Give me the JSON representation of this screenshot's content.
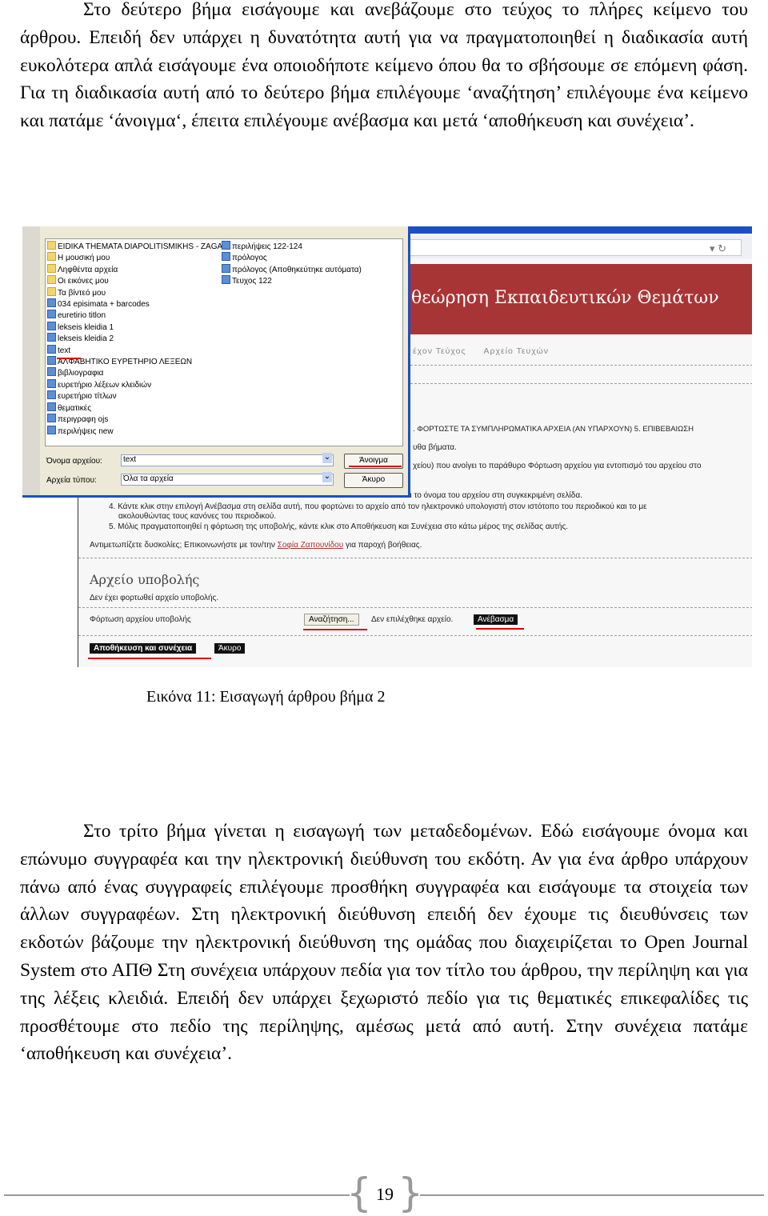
{
  "paragraphs": [
    "Στο δεύτερο βήμα εισάγουμε και ανεβάζουμε στο τεύχος το πλήρες κείμενο του άρθρου. Επειδή δεν υπάρχει η δυνατότητα αυτή για να πραγματοποιηθεί η διαδικασία αυτή ευκολότερα απλά εισάγουμε ένα οποιοδήποτε κείμενο όπου θα το σβήσουμε σε επόμενη φάση. Για τη διαδικασία αυτή από το δεύτερο βήμα επιλέγουμε ‘αναζήτηση’ επιλέγουμε ένα κείμενο και πατάμε ‘άνοιγμα‘, έπειτα επιλέγουμε ανέβασμα και μετά ‘αποθήκευση και συνέχεια’.",
    "Στο τρίτο βήμα γίνεται η εισαγωγή των μεταδεδομένων. Εδώ εισάγουμε όνομα και επώνυμο συγγραφέα και την ηλεκτρονική διεύθυνση του εκδότη. Αν για ένα άρθρο υπάρχουν πάνω από ένας συγγραφείς επιλέγουμε προσθήκη συγγραφέα και εισάγουμε τα στοιχεία των άλλων συγγραφέων. Στη ηλεκτρονική διεύθυνση επειδή δεν έχουμε τις διευθύνσεις των εκδοτών βάζουμε την ηλεκτρονική διεύθυνση της ομάδας που διαχειρίζεται το Open Journal System στο ΑΠΘ Στη συνέχεια υπάρχουν πεδία για τον τίτλο του άρθρου, την περίληψη και για της λέξεις κλειδιά. Επειδή δεν υπάρχει ξεχωριστό πεδίο για τις θεματικές επικεφαλίδες τις προσθέτουμε στο πεδίο της περίληψης, αμέσως μετά από αυτή. Στην συνέχεια πατάμε ‘αποθήκευση και συνέχεια’."
  ],
  "figure": {
    "caption": "Εικόνα 11: Εισαγωγή άρθρου βήμα 2",
    "web": {
      "banner": "θεώρηση Εκπαιδευτικών Θεμάτων",
      "nav": [
        "έχον Τεύχος",
        "Αρχείο Τευχών"
      ],
      "steps_header": ". ΦΟΡΤΩΣΤΕ ΤΑ ΣΥΜΠΛΗΡΩΜΑΤΙΚΑ ΑΡΧΕΙΑ (ΑΝ ΥΠΑΡΧΟΥΝ)   5. ΕΠΙΒΕΒΑΙΩΣΗ",
      "line1": "υθα βήματα.",
      "line2": "χείου) που ανοίγει το παράθυρο Φόρτωση αρχείου για εντοπισμό του αρχείου στο",
      "line3": "ει το όνομα του αρχείου στη συγκεκριμένη σελίδα.",
      "step4": "4. Κάντε κλικ στην επιλογή Ανέβασμα στη σελίδα αυτή, που φορτώνει το αρχείο από τον ηλεκτρονικό υπολογιστή στον ιστότοπο του περιοδικού και το με",
      "step4b": "ακολουθώντας τους κανόνες του περιοδικού.",
      "step5": "5. Μόλις πραγματοποιηθεί η φόρτωση της υποβολής, κάντε κλικ στο Αποθήκευση και Συνέχεια στο κάτω μέρος της σελίδας αυτής.",
      "help_prefix": "Αντιμετωπίζετε δυσκολίες; Επικοινωνήστε με τον/την ",
      "help_link": "Σοφία Ζαπουνίδου",
      "help_suffix": " για παροχή βοήθειας.",
      "section_title": "Αρχείο υποβολής",
      "no_file": "Δεν έχει φορτωθεί αρχείο υποβολής.",
      "upload_label": "Φόρτωση αρχείου υποβολής",
      "browse_button": "Αναζήτηση...",
      "no_file_selected": "Δεν επιλέχθηκε αρχείο.",
      "upload_button": "Ανέβασμα",
      "save_button": "Αποθήκευση και συνέχεια",
      "cancel_button": "Άκυρο"
    },
    "dialog": {
      "files_col1": [
        "EIDIKA THEMATA DIAPOLITISMIKHS - ZAGA",
        "Η μουσική μου",
        "Ληφθέντα αρχεία",
        "Οι εικόνες μου",
        "Τα βίντεό μου",
        "034 episimata + barcodes",
        "euretirio titlon",
        "lekseis kleidia 1",
        "lekseis kleidia 2",
        "text",
        "ΑΛΦΑΒΗΤΙΚΟ ΕΥΡΕΤΗΡΙΟ ΛΕΞΕΩΝ",
        "βιβλιογραφια",
        "ευρετήριο λέξεων κλειδιών",
        "ευρετήριο τίτλων",
        "θεματικές",
        "περιγραφη ojs",
        "περιλήψεις new"
      ],
      "files_col2": [
        "περιλήψεις 122-124",
        "πρόλογος",
        "πρόλογος (Αποθηκεύτηκε αυτόματα)",
        "Τευχος 122"
      ],
      "filename_label": "Όνομα αρχείου:",
      "filename_value": "text",
      "filetype_label": "Αρχεία τύπου:",
      "filetype_value": "Όλα τα αρχεία",
      "open_button": "Άνοιγμα",
      "cancel_button": "Άκυρο"
    }
  },
  "footer": {
    "page_number": "19"
  }
}
